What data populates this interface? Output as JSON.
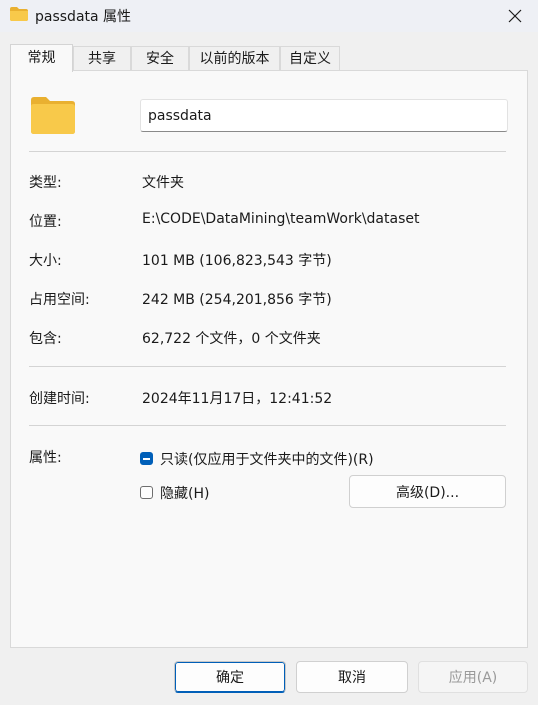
{
  "window": {
    "title": "passdata 属性"
  },
  "tabs": [
    {
      "label": "常规"
    },
    {
      "label": "共享"
    },
    {
      "label": "安全"
    },
    {
      "label": "以前的版本"
    },
    {
      "label": "自定义"
    }
  ],
  "general": {
    "name_value": "passdata",
    "fields": {
      "type": {
        "label": "类型:",
        "value": "文件夹"
      },
      "location": {
        "label": "位置:",
        "value": "E:\\CODE\\DataMining\\teamWork\\dataset"
      },
      "size": {
        "label": "大小:",
        "value": "101 MB (106,823,543 字节)"
      },
      "size_on_disk": {
        "label": "占用空间:",
        "value": "242 MB (254,201,856 字节)"
      },
      "contains": {
        "label": "包含:",
        "value": "62,722 个文件，0 个文件夹"
      },
      "created": {
        "label": "创建时间:",
        "value": "2024年11月17日，12:41:52"
      }
    },
    "attributes": {
      "label": "属性:",
      "readonly": {
        "label": "只读(仅应用于文件夹中的文件)(R)",
        "state": "indeterminate"
      },
      "hidden": {
        "label": "隐藏(H)",
        "state": "unchecked"
      },
      "advanced_label": "高级(D)..."
    }
  },
  "footer": {
    "ok_label": "确定",
    "cancel_label": "取消",
    "apply_label": "应用(A)"
  },
  "colors": {
    "accent": "#005fb8",
    "folder": "#f8c94a"
  },
  "icons": {
    "title": "folder-icon",
    "close": "close-icon",
    "large": "folder-icon"
  }
}
